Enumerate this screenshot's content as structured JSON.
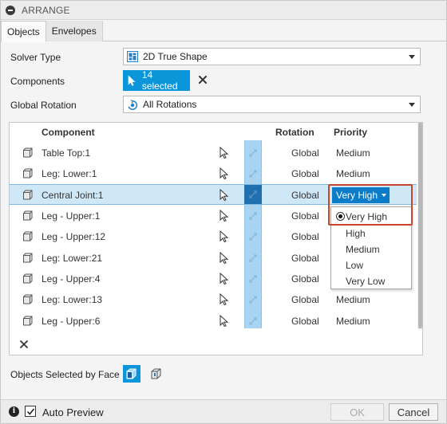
{
  "panel": {
    "title": "ARRANGE"
  },
  "tabs": [
    {
      "label": "Objects",
      "active": true
    },
    {
      "label": "Envelopes",
      "active": false
    }
  ],
  "solver": {
    "label": "Solver Type",
    "value": "2D True Shape"
  },
  "components": {
    "label": "Components",
    "selected_text": "14 selected"
  },
  "rotation": {
    "label": "Global Rotation",
    "value": "All Rotations"
  },
  "table": {
    "headers": {
      "component": "Component",
      "rotation": "Rotation",
      "priority": "Priority"
    },
    "rows": [
      {
        "name": "Table Top:1",
        "rotation": "Global",
        "priority": "Medium"
      },
      {
        "name": "Leg: Lower:1",
        "rotation": "Global",
        "priority": "Medium"
      },
      {
        "name": "Central Joint:1",
        "rotation": "Global",
        "priority": "Very High",
        "selected": true
      },
      {
        "name": "Leg - Upper:1",
        "rotation": "Global",
        "priority": ""
      },
      {
        "name": "Leg - Upper:12",
        "rotation": "Global",
        "priority": ""
      },
      {
        "name": "Leg: Lower:21",
        "rotation": "Global",
        "priority": ""
      },
      {
        "name": "Leg - Upper:4",
        "rotation": "Global",
        "priority": ""
      },
      {
        "name": "Leg: Lower:13",
        "rotation": "Global",
        "priority": "Medium"
      },
      {
        "name": "Leg - Upper:6",
        "rotation": "Global",
        "priority": "Medium"
      }
    ]
  },
  "priority_menu": {
    "selected": "Very High",
    "options": [
      "Very High",
      "High",
      "Medium",
      "Low",
      "Very Low"
    ]
  },
  "face_selection": {
    "label": "Objects Selected by Face"
  },
  "footer": {
    "auto_preview_label": "Auto Preview",
    "auto_preview_checked": true,
    "ok_label": "OK",
    "cancel_label": "Cancel"
  },
  "colors": {
    "accent": "#0a96d8",
    "selection_row": "#cfe8f8",
    "highlight": "#c7462b"
  }
}
